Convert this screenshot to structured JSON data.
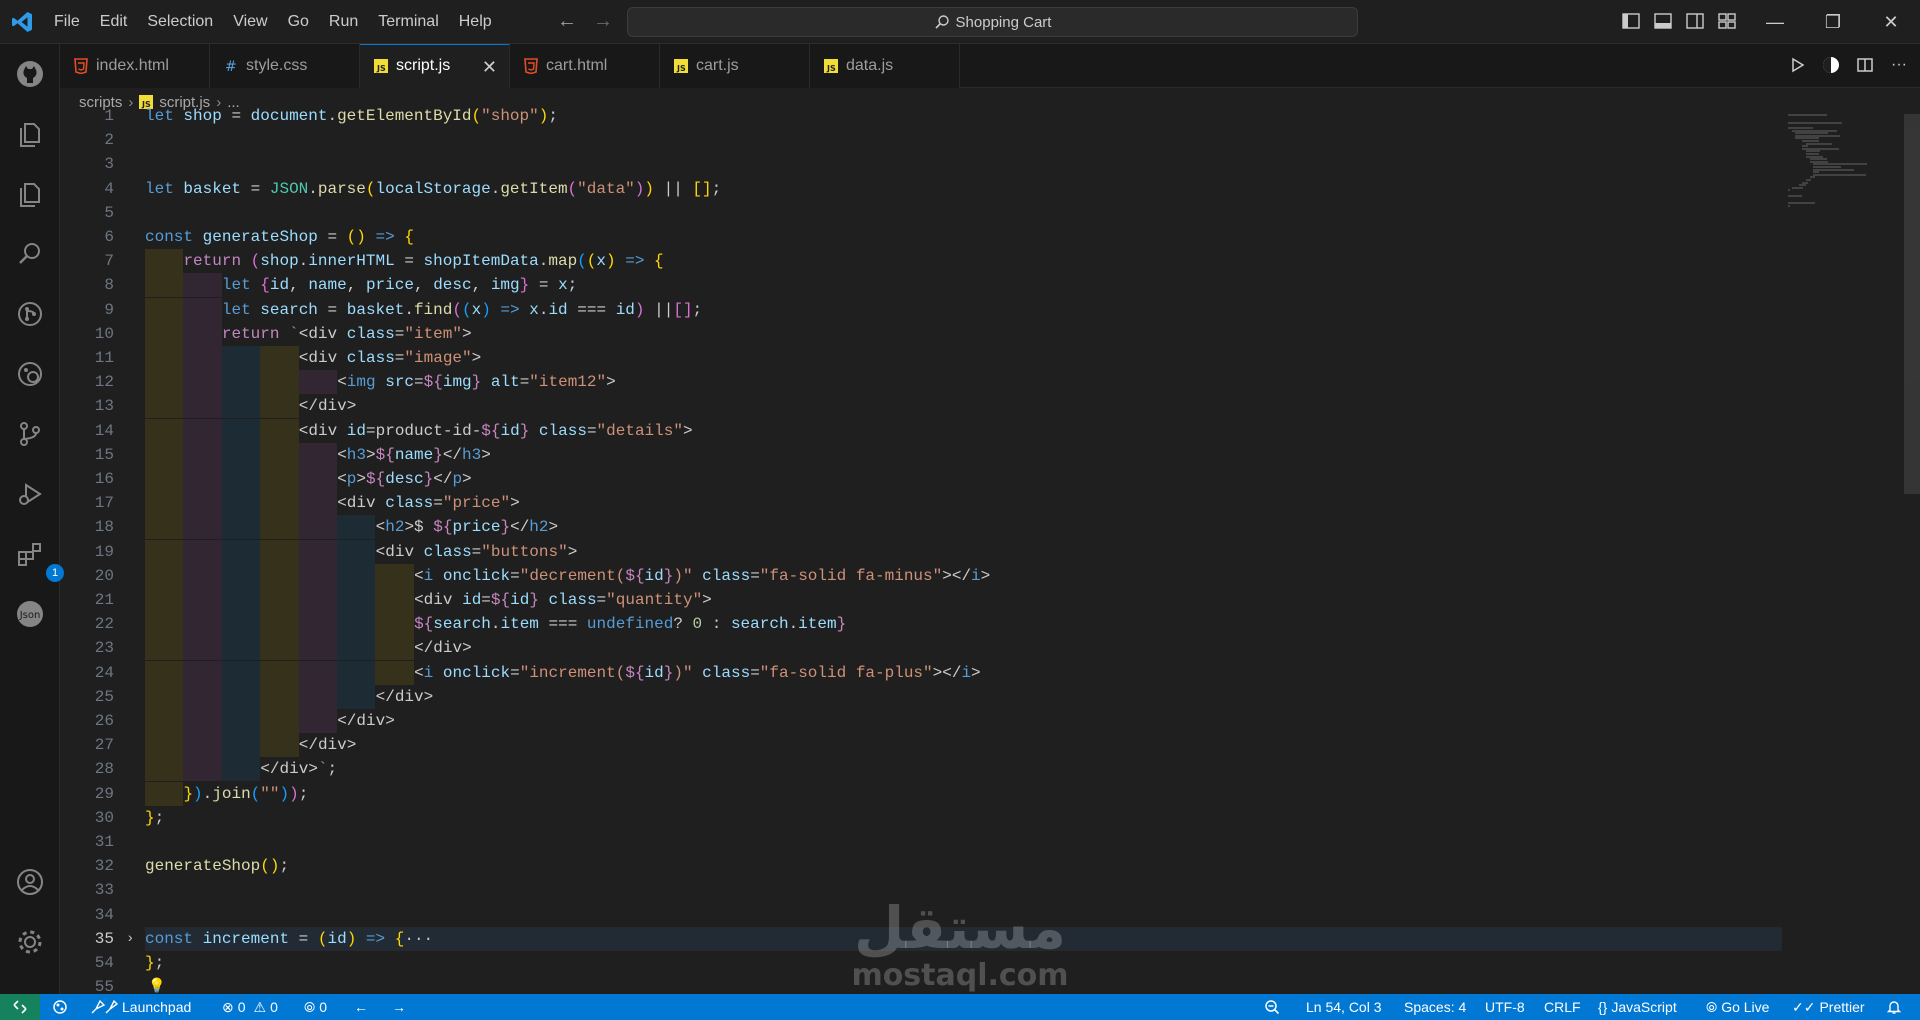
{
  "window": {
    "menu": [
      "File",
      "Edit",
      "Selection",
      "View",
      "Go",
      "Run",
      "Terminal",
      "Help"
    ],
    "search_text": "Shopping Cart",
    "accent_color": "#0078d4"
  },
  "tabs": [
    {
      "label": "index.html",
      "icon": "html-file-icon",
      "active": false
    },
    {
      "label": "style.css",
      "icon": "css-file-icon",
      "active": false
    },
    {
      "label": "script.js",
      "icon": "js-file-icon",
      "active": true
    },
    {
      "label": "cart.html",
      "icon": "html-file-icon",
      "active": false
    },
    {
      "label": "cart.js",
      "icon": "js-file-icon",
      "active": false
    },
    {
      "label": "data.js",
      "icon": "js-file-icon",
      "active": false
    }
  ],
  "breadcrumb": {
    "folder": "scripts",
    "file": "script.js",
    "symbol": "..."
  },
  "activity_bar": {
    "icons": [
      "github-icon",
      "explorer-icon",
      "files-icon",
      "search-icon",
      "source-control-icon",
      "remote-icon",
      "branch-icon",
      "run-debug-icon",
      "extensions-icon",
      "json-icon",
      "account-icon",
      "settings-gear-icon"
    ],
    "extensions_badge": "1"
  },
  "editor": {
    "line_numbers": [
      "1",
      "2",
      "3",
      "4",
      "5",
      "6",
      "7",
      "8",
      "9",
      "10",
      "11",
      "12",
      "13",
      "14",
      "15",
      "16",
      "17",
      "18",
      "19",
      "20",
      "21",
      "22",
      "23",
      "24",
      "25",
      "26",
      "27",
      "28",
      "29",
      "30",
      "31",
      "32",
      "33",
      "34",
      "35",
      "54",
      "55"
    ],
    "lines": [
      "let shop = document.getElementById(\"shop\");",
      "",
      "",
      "let basket = JSON.parse(localStorage.getItem(\"data\")) || [];",
      "",
      "const generateShop = () => {",
      "    return (shop.innerHTML = shopItemData.map((x) => {",
      "        let {id, name, price, desc, img} = x;",
      "        let search = basket.find((x) => x.id === id) ||[];",
      "        return `<div class=\"item\">",
      "                <div class=\"image\">",
      "                    <img src=${img} alt=\"item12\">",
      "                </div>",
      "                <div id=product-id-${id} class=\"details\">",
      "                    <h3>${name}</h3>",
      "                    <p>${desc}</p>",
      "                    <div class=\"price\">",
      "                        <h2>$ ${price}</h2>",
      "                        <div class=\"buttons\">",
      "                            <i onclick=\"decrement(${id})\" class=\"fa-solid fa-minus\"></i>",
      "                            <div id=${id} class=\"quantity\">",
      "                            ${search.item === undefined? 0 : search.item}",
      "                            </div>",
      "                            <i onclick=\"increment(${id})\" class=\"fa-solid fa-plus\"></i>",
      "                        </div>",
      "                    </div>",
      "                </div>",
      "            </div>`;",
      "    }).join(\"\"));",
      "};",
      "",
      "generateShop();",
      "",
      "",
      "const increment = (id) => {···",
      "};",
      ""
    ]
  },
  "status_bar": {
    "launchpad": "Launchpad",
    "errors": "0",
    "warnings": "0",
    "ports": "0",
    "position": "Ln 54, Col 3",
    "spaces": "Spaces: 4",
    "encoding": "UTF-8",
    "eol": "CRLF",
    "language": "JavaScript",
    "go_live": "Go Live",
    "prettier": "Prettier"
  },
  "watermark": {
    "arabic": "مستقل",
    "latin": "mostaql.com"
  }
}
